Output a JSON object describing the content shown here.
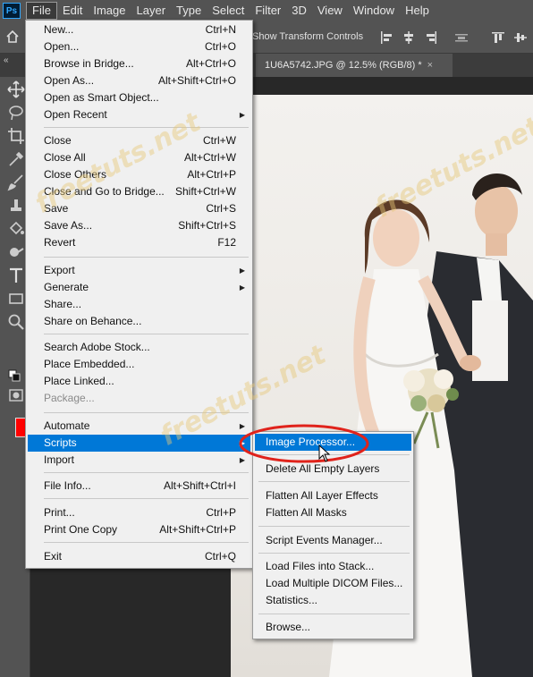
{
  "app": {
    "logo": "Ps"
  },
  "menubar": {
    "items": [
      "File",
      "Edit",
      "Image",
      "Layer",
      "Type",
      "Select",
      "Filter",
      "3D",
      "View",
      "Window",
      "Help"
    ],
    "active_index": 0
  },
  "options_bar": {
    "show_transform_controls": "Show Transform Controls"
  },
  "document": {
    "tab_title": "1U6A5742.JPG @ 12.5% (RGB/8) *",
    "close_glyph": "×"
  },
  "colors": {
    "foreground": "#ff0000",
    "highlight": "#0078d7",
    "annotation": "#e0231b"
  },
  "file_menu": {
    "items": [
      {
        "label": "New...",
        "shortcut": "Ctrl+N"
      },
      {
        "label": "Open...",
        "shortcut": "Ctrl+O"
      },
      {
        "label": "Browse in Bridge...",
        "shortcut": "Alt+Ctrl+O"
      },
      {
        "label": "Open As...",
        "shortcut": "Alt+Shift+Ctrl+O"
      },
      {
        "label": "Open as Smart Object...",
        "shortcut": ""
      },
      {
        "label": "Open Recent",
        "shortcut": "",
        "submenu": true
      },
      {
        "label": "Close",
        "shortcut": "Ctrl+W"
      },
      {
        "label": "Close All",
        "shortcut": "Alt+Ctrl+W"
      },
      {
        "label": "Close Others",
        "shortcut": "Alt+Ctrl+P"
      },
      {
        "label": "Close and Go to Bridge...",
        "shortcut": "Shift+Ctrl+W"
      },
      {
        "label": "Save",
        "shortcut": "Ctrl+S"
      },
      {
        "label": "Save As...",
        "shortcut": "Shift+Ctrl+S"
      },
      {
        "label": "Revert",
        "shortcut": "F12"
      },
      {
        "label": "Export",
        "shortcut": "",
        "submenu": true
      },
      {
        "label": "Generate",
        "shortcut": "",
        "submenu": true
      },
      {
        "label": "Share...",
        "shortcut": ""
      },
      {
        "label": "Share on Behance...",
        "shortcut": ""
      },
      {
        "label": "Search Adobe Stock...",
        "shortcut": ""
      },
      {
        "label": "Place Embedded...",
        "shortcut": ""
      },
      {
        "label": "Place Linked...",
        "shortcut": ""
      },
      {
        "label": "Package...",
        "shortcut": "",
        "disabled": true
      },
      {
        "label": "Automate",
        "shortcut": "",
        "submenu": true
      },
      {
        "label": "Scripts",
        "shortcut": "",
        "submenu": true,
        "highlighted": true
      },
      {
        "label": "Import",
        "shortcut": "",
        "submenu": true
      },
      {
        "label": "File Info...",
        "shortcut": "Alt+Shift+Ctrl+I"
      },
      {
        "label": "Print...",
        "shortcut": "Ctrl+P"
      },
      {
        "label": "Print One Copy",
        "shortcut": "Alt+Shift+Ctrl+P"
      },
      {
        "label": "Exit",
        "shortcut": "Ctrl+Q"
      }
    ]
  },
  "scripts_submenu": {
    "items": [
      {
        "label": "Image Processor...",
        "highlighted": true
      },
      {
        "label": "Delete All Empty Layers"
      },
      {
        "label": "Flatten All Layer Effects"
      },
      {
        "label": "Flatten All Masks"
      },
      {
        "label": "Script Events Manager..."
      },
      {
        "label": "Load Files into Stack..."
      },
      {
        "label": "Load Multiple DICOM Files..."
      },
      {
        "label": "Statistics..."
      },
      {
        "label": "Browse..."
      }
    ]
  },
  "watermark": "freetuts.net"
}
